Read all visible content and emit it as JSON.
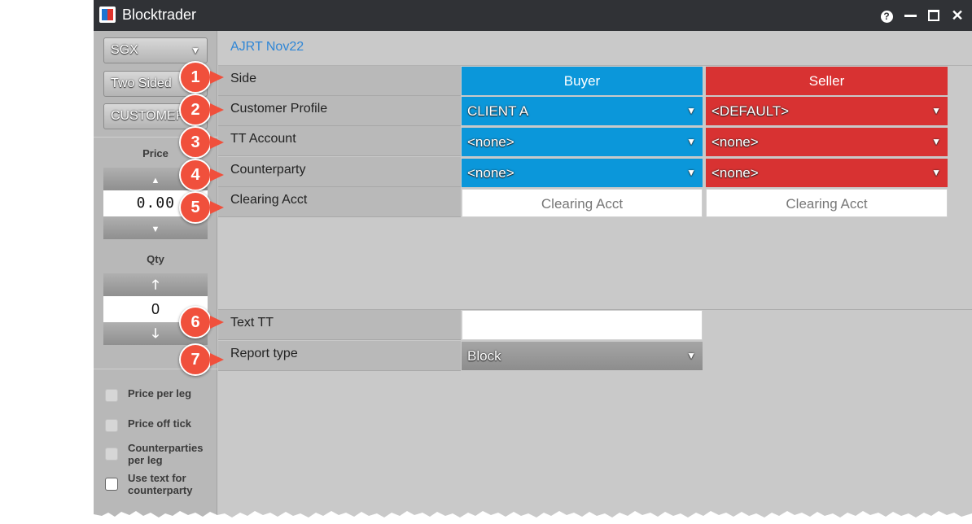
{
  "window": {
    "title": "Blocktrader",
    "controls": {
      "help": "?",
      "close": "✕"
    }
  },
  "sidebar": {
    "exchange": "SGX",
    "mode": "Two Sided",
    "profile_button": "CUSTOMER",
    "price_label": "Price",
    "price_value": "0.00",
    "qty_label": "Qty",
    "qty_value": "0",
    "checkboxes": [
      {
        "label": "Price per leg",
        "checked": false,
        "enabled": false
      },
      {
        "label": "Price off tick",
        "checked": false,
        "enabled": false
      },
      {
        "label": "Counterparties per leg",
        "checked": false,
        "enabled": false
      },
      {
        "label": "Use text for counterparty",
        "checked": false,
        "enabled": true
      }
    ]
  },
  "main": {
    "contract": "AJRT Nov22",
    "rows": [
      {
        "label": "Side",
        "buyer": "Buyer",
        "seller": "Seller"
      },
      {
        "label": "Customer Profile",
        "buyer": "CLIENT A",
        "seller": "<DEFAULT>"
      },
      {
        "label": "TT Account",
        "buyer": "<none>",
        "seller": "<none>"
      },
      {
        "label": "Counterparty",
        "buyer": "<none>",
        "seller": "<none>"
      },
      {
        "label": "Clearing Acct",
        "buyer": "Clearing Acct",
        "seller": "Clearing Acct"
      }
    ],
    "text_tt": {
      "label": "Text TT",
      "value": ""
    },
    "report_type": {
      "label": "Report type",
      "value": "Block"
    }
  },
  "callouts": [
    "1",
    "2",
    "3",
    "4",
    "5",
    "6",
    "7"
  ],
  "colors": {
    "buyer": "#0b97da",
    "seller": "#d83232",
    "callout": "#f0503c",
    "contract_title": "#2f86d6",
    "titlebar": "#303236"
  }
}
